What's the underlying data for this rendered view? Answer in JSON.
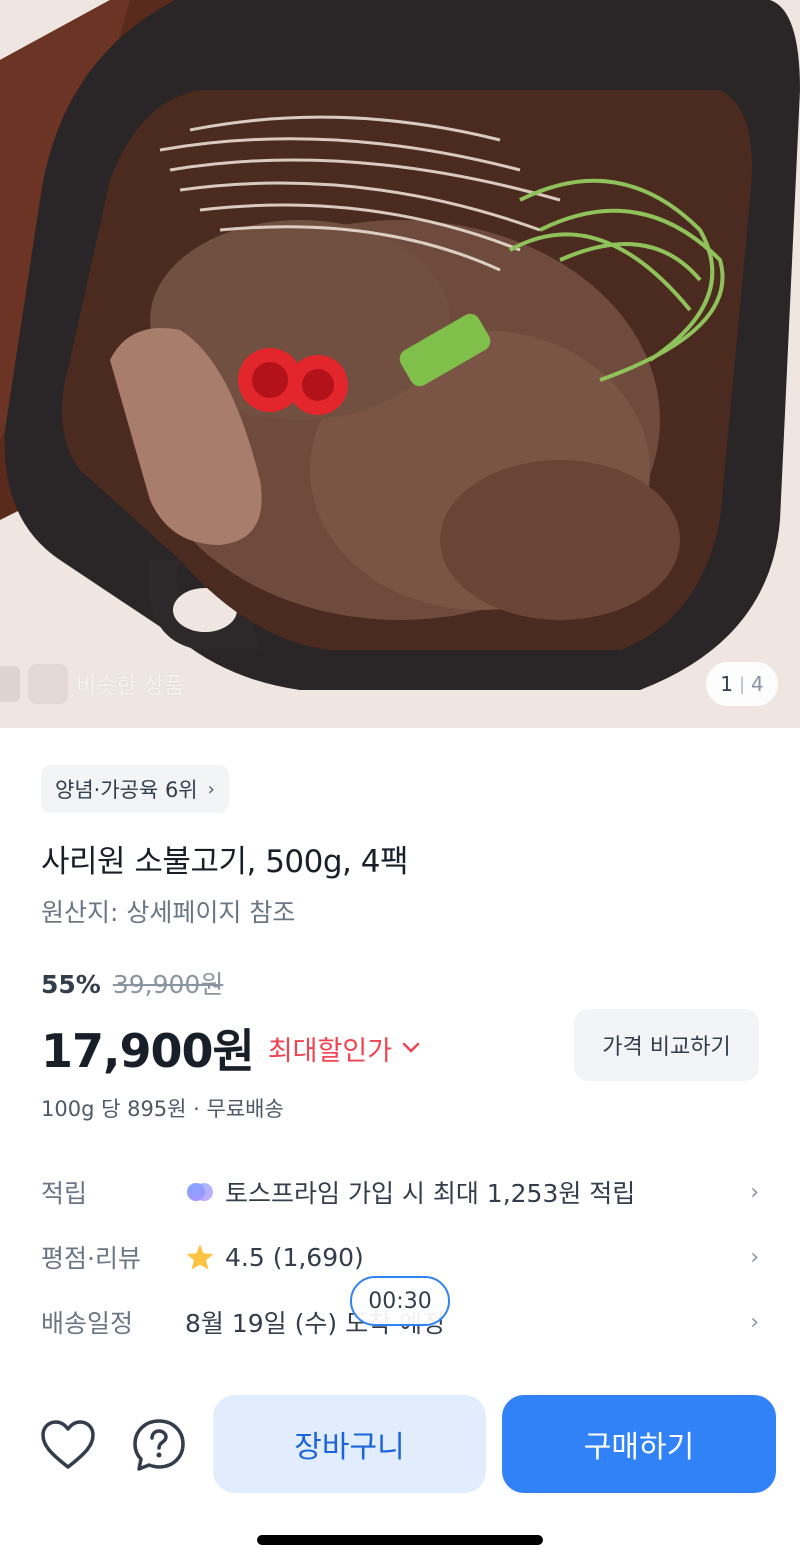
{
  "gallery": {
    "current_page": "1",
    "total_pages": "4",
    "similar_label": "비슷한 상품"
  },
  "category_chip": {
    "label": "양념·가공육 6위"
  },
  "product": {
    "title": "사리원 소불고기, 500g, 4팩",
    "origin": "원산지: 상세페이지 참조"
  },
  "pricing": {
    "discount_rate": "55%",
    "original_price": "39,900원",
    "sale_price": "17,900원",
    "max_discount_label": "최대할인가",
    "compare_button": "가격 비교하기",
    "unit_info": "100g 당 895원 · 무료배송"
  },
  "info_rows": [
    {
      "label": "적립",
      "value": "토스프라임 가입 시 최대 1,253원 적립",
      "icon": "toss-prime-icon"
    },
    {
      "label": "평점·리뷰",
      "value": "4.5 (1,690)",
      "icon": "star-icon"
    },
    {
      "label": "배송일정",
      "value": "8월 19일 (수) 도착 예정",
      "icon": ""
    }
  ],
  "timer": {
    "text": "00:30"
  },
  "bottom_bar": {
    "cart_label": "장바구니",
    "buy_label": "구매하기"
  },
  "colors": {
    "accent": "#3182f6",
    "discount_red": "#f04452",
    "cart_bg": "#e1ecfd",
    "star": "#ffc342"
  }
}
